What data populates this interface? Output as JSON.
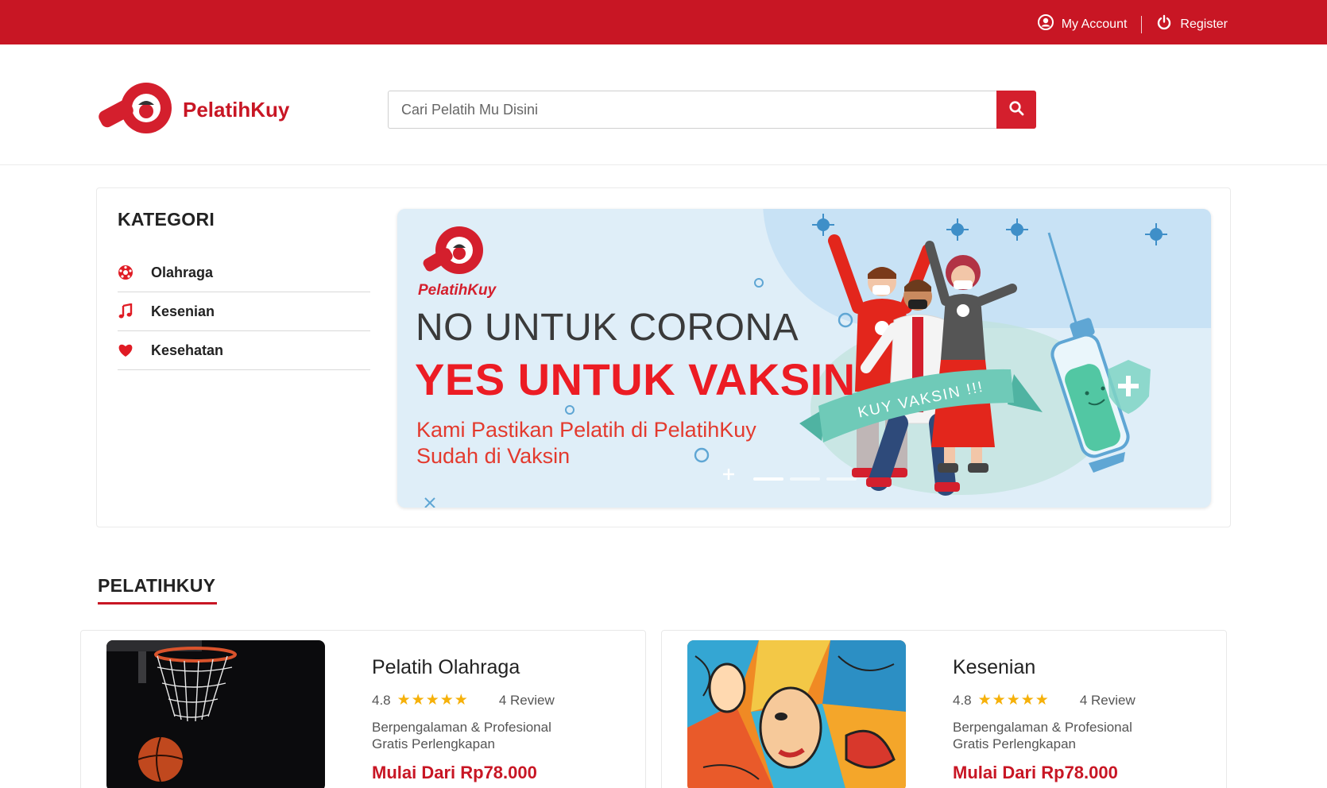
{
  "topbar": {
    "my_account": "My Account",
    "register": "Register"
  },
  "header": {
    "brand": "PelatihKuy",
    "search_placeholder": "Cari Pelatih Mu Disini"
  },
  "sidebar": {
    "title": "KATEGORI",
    "items": [
      {
        "label": "Olahraga",
        "icon": "soccer-ball-icon"
      },
      {
        "label": "Kesenian",
        "icon": "music-note-icon"
      },
      {
        "label": "Kesehatan",
        "icon": "heart-icon"
      }
    ]
  },
  "banner": {
    "brand": "PelatihKuy",
    "line1": "NO UNTUK CORONA",
    "line2": "YES UNTUK VAKSIN",
    "subtitle": "Kami Pastikan Pelatih di PelatihKuy Sudah di Vaksin",
    "ribbon": "KUY VAKSIN !!!",
    "person_badge": "PelatihKuy",
    "slides": 3,
    "active_slide": 1
  },
  "section": {
    "title": "PELATIHKUY"
  },
  "cards": [
    {
      "title": "Pelatih Olahraga",
      "rating": "4.8",
      "stars": "★★★★★",
      "reviews": "4 Review",
      "feature1": "Berpengalaman & Profesional",
      "feature2": "Gratis Perlengkapan",
      "price": "Mulai Dari Rp78.000",
      "image": "basketball-hoop-photo"
    },
    {
      "title": "Kesenian",
      "rating": "4.8",
      "stars": "★★★★★",
      "reviews": "4 Review",
      "feature1": "Berpengalaman & Profesional",
      "feature2": "Gratis Perlengkapan",
      "price": "Mulai Dari Rp78.000",
      "image": "street-art-mural-photo"
    }
  ],
  "colors": {
    "brand_red": "#c81624",
    "accent_red": "#ec1c24",
    "star": "#f6b10a"
  }
}
